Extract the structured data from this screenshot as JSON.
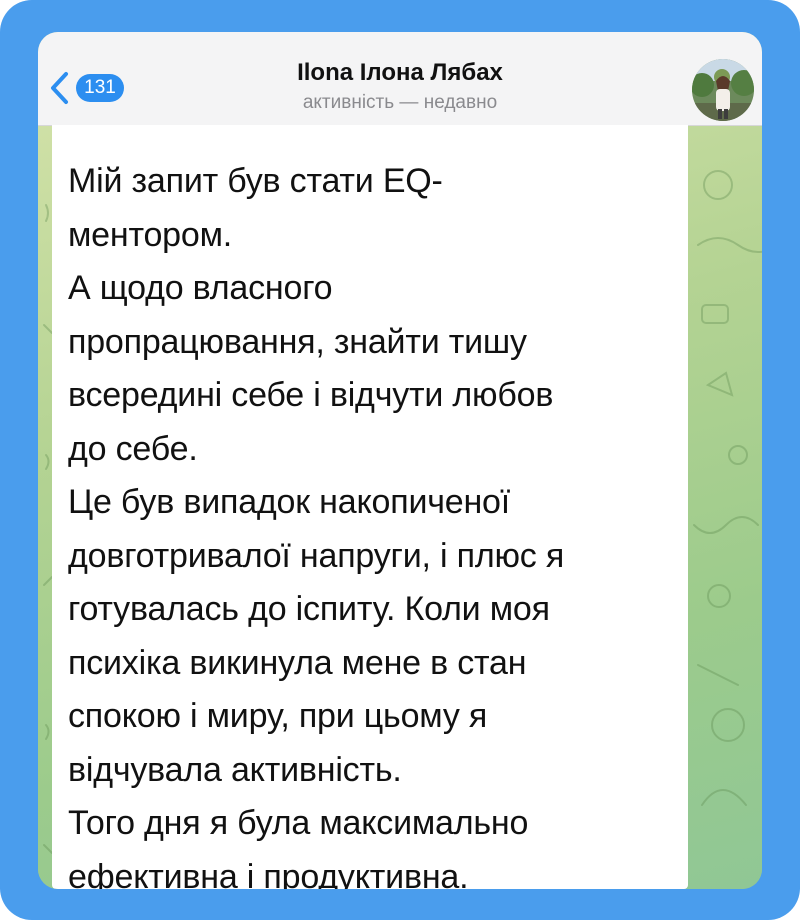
{
  "header": {
    "back_label": "‹",
    "unread_count": "131",
    "contact_name": "Ilona Ілона Лябах",
    "status": "активність — недавно"
  },
  "message": {
    "lines": [
      "Мій запит був стати EQ-",
      "ментором.",
      "А щодо власного",
      "пропрацювання, знайти тишу",
      "всередині себе і відчути любов",
      "до себе.",
      "Це був випадок накопиченої",
      "довготривалої напруги, і плюс я",
      "готувалась до іспиту. Коли моя",
      "психіка викинула мене в стан",
      "спокою і миру, при цьому я",
      "відчувала активність.",
      "Того дня я була максимально",
      "ефективна і продуктивна."
    ]
  },
  "colors": {
    "frame_blue": "#4a9ded",
    "accent_blue": "#2c8ef0",
    "chat_green": "#b4d393"
  },
  "icons": {
    "back": "chevron-left-icon",
    "avatar": "contact-avatar-photo"
  }
}
